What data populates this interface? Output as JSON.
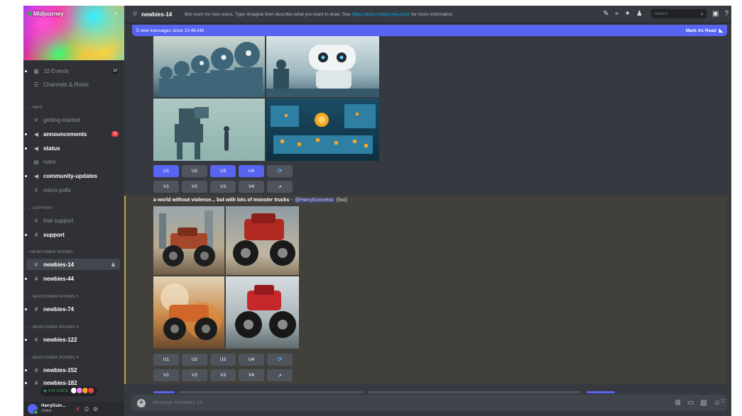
{
  "server": {
    "name": "Midjourney",
    "chevron": "⌄"
  },
  "sidebar": {
    "events": {
      "label": "10 Events",
      "count": "10"
    },
    "channels_roles": "Channels & Roles",
    "categories": {
      "info": "INFO",
      "support": "SUPPORT",
      "newcomer": "NEWCOMER ROOMS",
      "newcomer2": "NEWCOMER ROOMS 2",
      "newcomer3": "NEWCOMER ROOMS 3",
      "newcomer4": "NEWCOMER ROOMS 4"
    },
    "channels": {
      "getting_started": "getting-started",
      "announcements": "announcements",
      "announcements_badge": "8",
      "status": "status",
      "rules": "rules",
      "community_updates": "community-updates",
      "micro_polls": "micro-polls",
      "trial_support": "trial-support",
      "support": "support",
      "newbies14": "newbies-14",
      "newbies44": "newbies-44",
      "newbies74": "newbies-74",
      "newbies122": "newbies-122",
      "newbies152": "newbies-152",
      "newbies182": "newbies-182"
    },
    "voice": "4 IN VOICE"
  },
  "user": {
    "name": "HarryGuin...",
    "status": "Online"
  },
  "header": {
    "channel": "newbies-14",
    "topic_pre": "Bot room for new users. Type /imagine then describe what you want to draw. See ",
    "topic_link": "https://docs.midjourney.com/",
    "topic_post": " for more information",
    "search_placeholder": "Search"
  },
  "banner": {
    "text": "5 new messages since 10:46 AM",
    "mark_read": "Mark As Read"
  },
  "buttons": {
    "u": [
      "U1",
      "U2",
      "U3",
      "U4"
    ],
    "v": [
      "V1",
      "V2",
      "V3",
      "V4"
    ],
    "refresh_icon": "⟳",
    "open_icon": "↗"
  },
  "message2": {
    "prompt": "a world without violence... but with lots of monster trucks",
    "separator": " - ",
    "mention": "@HarryGuinness",
    "speed": " (fast)"
  },
  "composer": {
    "placeholder": "Message #newbies-14"
  },
  "colors": {
    "blurple": "#5865f2",
    "sidebar": "#2f3136",
    "chat": "#36393f",
    "highlight": "#41403a"
  }
}
